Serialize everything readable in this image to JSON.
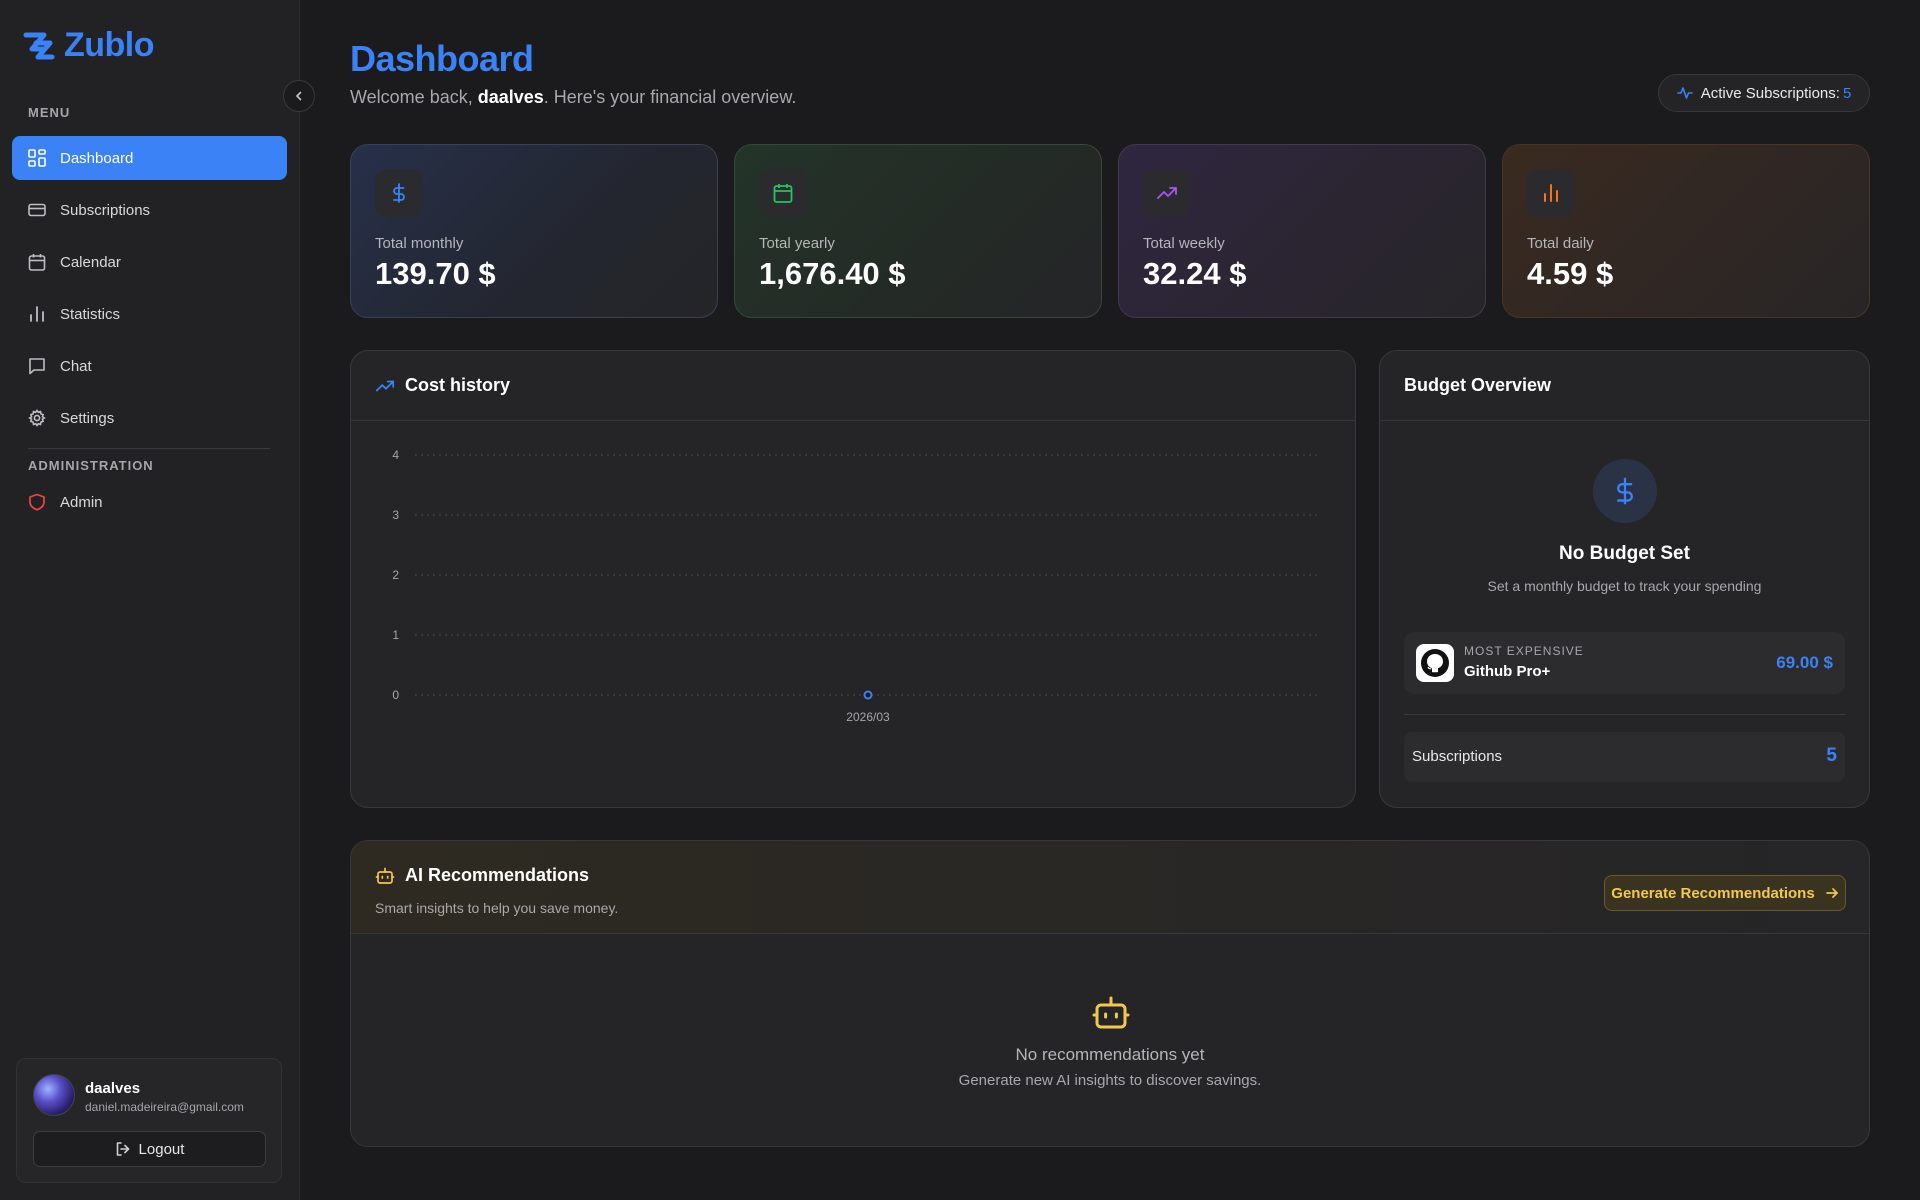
{
  "app": {
    "name": "Zublo"
  },
  "sidebar": {
    "menu_label": "MENU",
    "items": [
      {
        "label": "Dashboard",
        "icon": "dashboard-icon",
        "active": true
      },
      {
        "label": "Subscriptions",
        "icon": "credit-card-icon"
      },
      {
        "label": "Calendar",
        "icon": "calendar-icon"
      },
      {
        "label": "Statistics",
        "icon": "bar-chart-icon"
      },
      {
        "label": "Chat",
        "icon": "chat-icon"
      },
      {
        "label": "Settings",
        "icon": "gear-icon"
      }
    ],
    "admin_label": "ADMINISTRATION",
    "admin_item": {
      "label": "Admin",
      "icon": "shield-icon"
    },
    "user": {
      "name": "daalves",
      "email": "daniel.madeireira@gmail.com"
    },
    "logout_label": "Logout"
  },
  "header": {
    "title": "Dashboard",
    "welcome_prefix": "Welcome back, ",
    "username": "daalves",
    "welcome_suffix": ". Here's your financial overview.",
    "active_subs_label": "Active Subscriptions:",
    "active_subs_count": "5"
  },
  "stats": [
    {
      "label": "Total monthly",
      "value": "139.70 $",
      "icon": "dollar-icon",
      "color": "#3b82f6"
    },
    {
      "label": "Total yearly",
      "value": "1,676.40 $",
      "icon": "calendar-icon",
      "color": "#22c55e"
    },
    {
      "label": "Total weekly",
      "value": "32.24 $",
      "icon": "trending-up-icon",
      "color": "#a855f7"
    },
    {
      "label": "Total daily",
      "value": "4.59 $",
      "icon": "bar-chart-icon",
      "color": "#f97316"
    }
  ],
  "cost_history": {
    "title": "Cost history"
  },
  "chart_data": {
    "type": "line",
    "categories": [
      "2026/03"
    ],
    "values": [
      0
    ],
    "ylim": [
      0,
      4
    ],
    "yticks": [
      "0",
      "1",
      "2",
      "3",
      "4"
    ],
    "grid": true
  },
  "budget": {
    "title": "Budget Overview",
    "no_budget_title": "No Budget Set",
    "no_budget_sub": "Set a monthly budget to track your spending",
    "most_expensive_label": "MOST EXPENSIVE",
    "most_expensive_name": "Github Pro+",
    "most_expensive_price": "69.00 $",
    "subscriptions_label": "Subscriptions",
    "subscriptions_count": "5"
  },
  "ai": {
    "title": "AI Recommendations",
    "subtitle": "Smart insights to help you save money.",
    "button_label": "Generate Recommendations",
    "empty_title": "No recommendations yet",
    "empty_sub": "Generate new AI insights to discover savings."
  },
  "colors": {
    "accent": "#3b82f6",
    "warning": "#f2c94c",
    "admin": "#ef4444"
  }
}
